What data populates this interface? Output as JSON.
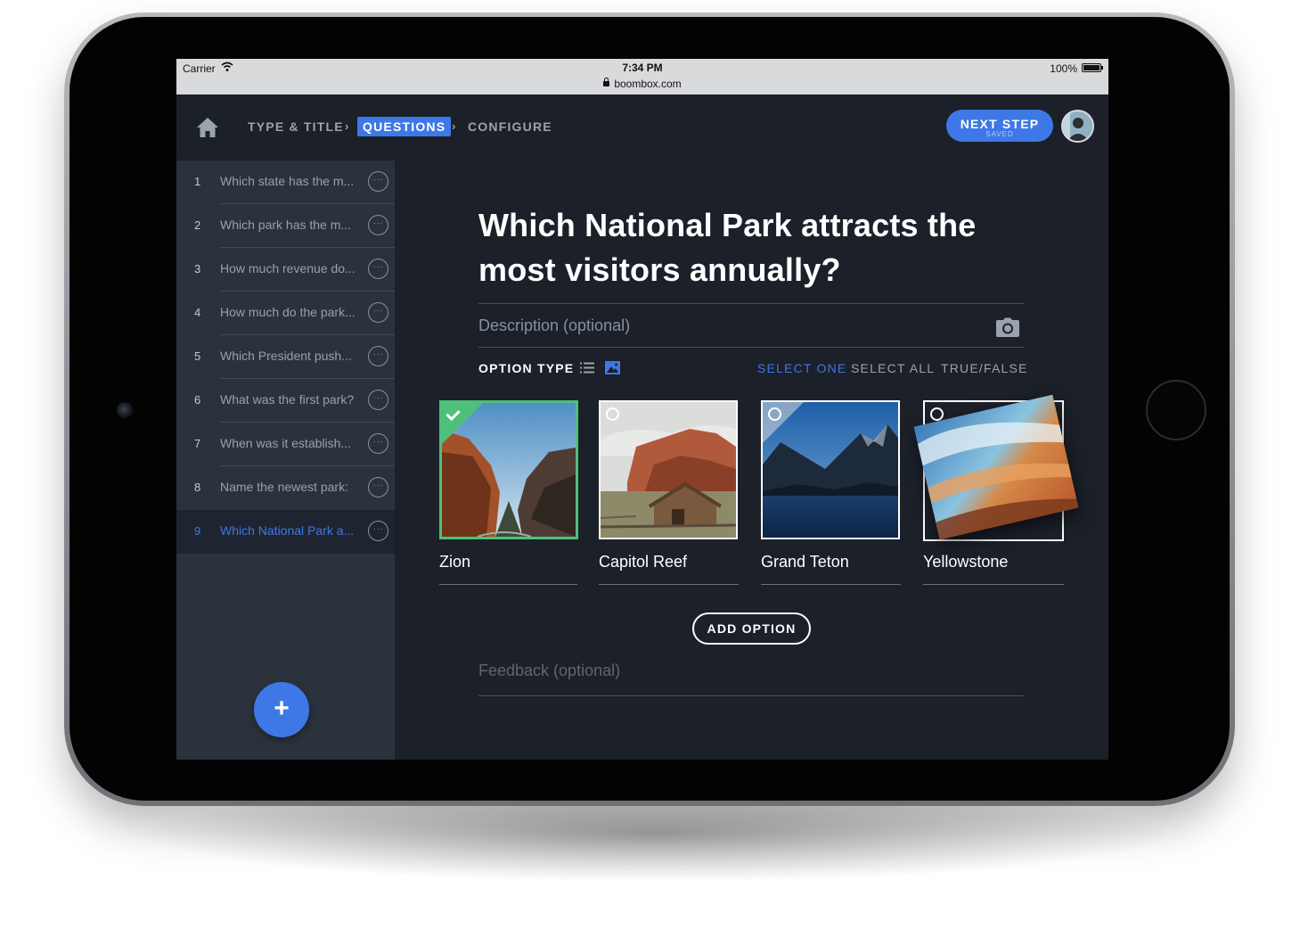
{
  "status_bar": {
    "carrier": "Carrier",
    "time": "7:34 PM",
    "url": "boombox.com",
    "battery": "100%"
  },
  "header": {
    "breadcrumbs": [
      "TYPE & TITLE",
      "QUESTIONS",
      "CONFIGURE"
    ],
    "active_breadcrumb": "QUESTIONS",
    "next_button": {
      "label": "NEXT STEP",
      "sub_label": "SAVED"
    }
  },
  "sidebar": {
    "questions": [
      {
        "number": "1",
        "text": "Which state has the m..."
      },
      {
        "number": "2",
        "text": "Which park has the m..."
      },
      {
        "number": "3",
        "text": "How much revenue do..."
      },
      {
        "number": "4",
        "text": "How much do the park..."
      },
      {
        "number": "5",
        "text": "Which President push..."
      },
      {
        "number": "6",
        "text": "What was the first park?"
      },
      {
        "number": "7",
        "text": "When was it establish..."
      },
      {
        "number": "8",
        "text": "Name the newest park:"
      },
      {
        "number": "9",
        "text": "Which National Park a..."
      }
    ],
    "active_question": "9",
    "more_glyph": "···",
    "add_glyph": "+"
  },
  "question": {
    "title": "Which National Park attracts the most visitors annually?",
    "description_placeholder": "Description (optional)",
    "option_type_label": "OPTION TYPE",
    "option_type_selected": "image",
    "modes": [
      "SELECT ONE",
      "SELECT ALL",
      "TRUE/FALSE"
    ],
    "active_mode": "SELECT ONE",
    "options": [
      {
        "label": "Zion",
        "selected": true,
        "image": "zion-canyon-photo"
      },
      {
        "label": "Capitol Reef",
        "selected": false,
        "image": "barn-and-red-cliffs-photo"
      },
      {
        "label": "Grand Teton",
        "selected": false,
        "image": "mountains-and-lake-photo"
      },
      {
        "label": "Yellowstone",
        "selected": false,
        "image": "hot-spring-photo"
      }
    ],
    "add_option_label": "ADD OPTION",
    "feedback_placeholder": "Feedback (optional)"
  },
  "colors": {
    "accent": "#3e78e6",
    "correct": "#4ec07a",
    "background": "#1b2029",
    "sidebar": "#2b323d"
  }
}
